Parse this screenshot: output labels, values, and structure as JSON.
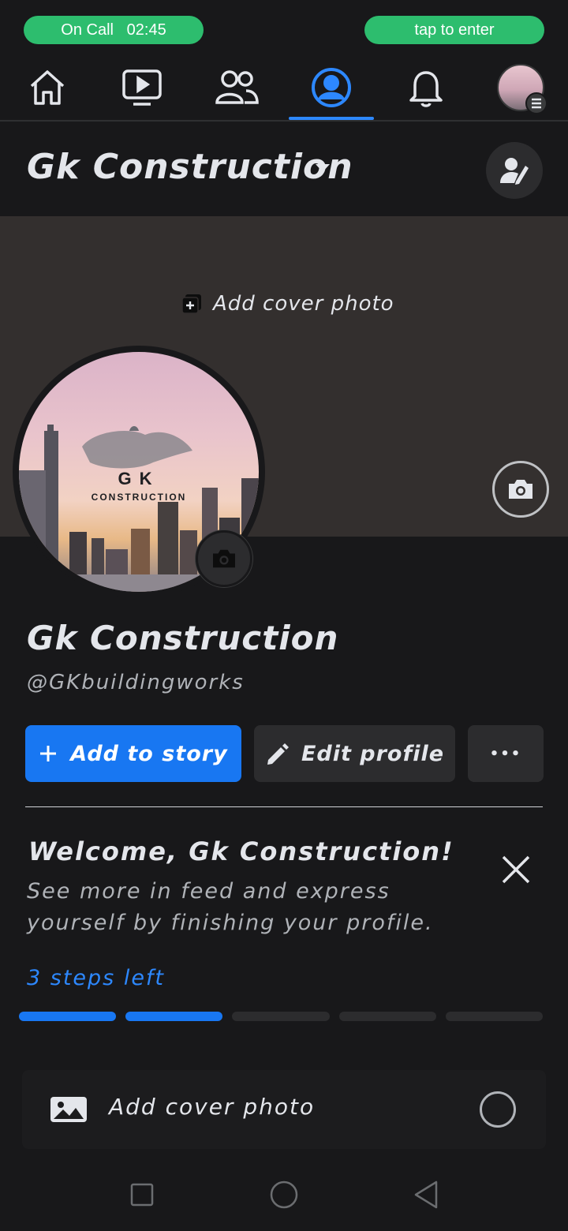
{
  "status": {
    "call_label": "On Call",
    "call_time": "02:45",
    "tap_label": "tap to enter"
  },
  "nav": {
    "items": [
      {
        "icon": "home-icon"
      },
      {
        "icon": "watch-icon"
      },
      {
        "icon": "friends-icon"
      },
      {
        "icon": "profile-icon",
        "active": true
      },
      {
        "icon": "bell-icon"
      },
      {
        "icon": "avatar-menu-icon"
      }
    ],
    "accent": "#2d88ff"
  },
  "header": {
    "title": "Gk Construction"
  },
  "cover": {
    "add_label": "Add cover photo"
  },
  "avatar": {
    "logo_top": "GK",
    "logo_sub": "CONSTRUCTION"
  },
  "profile": {
    "name": "Gk Construction",
    "handle": "@GKbuildingworks"
  },
  "actions": {
    "story_label": "Add to story",
    "edit_label": "Edit profile",
    "more_label": "•••"
  },
  "welcome": {
    "title": "Welcome, Gk Construction!",
    "body": "See more in feed and express yourself by finishing your profile.",
    "steps_left": "3 steps left",
    "steps_total": 5,
    "steps_done": 2
  },
  "task": {
    "label": "Add cover photo"
  },
  "colors": {
    "background": "#18181a",
    "primary": "#1877f2",
    "pill": "#2dbd6e"
  }
}
